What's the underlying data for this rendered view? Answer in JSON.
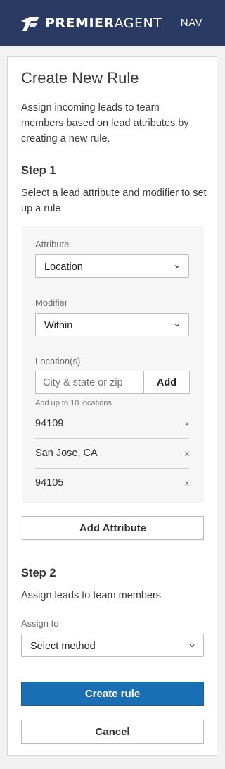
{
  "header": {
    "brand_bold": "PREMIER",
    "brand_light": "AGENT",
    "nav_label": "NAV",
    "color": "#2a3a63"
  },
  "form": {
    "title": "Create New Rule",
    "intro": "Assign incoming leads to team members based on lead attributes by creating a new rule.",
    "step1": {
      "heading": "Step 1",
      "description": "Select a lead attribute and modifier to set up a rule",
      "attribute_label": "Attribute",
      "attribute_value": "Location",
      "modifier_label": "Modifier",
      "modifier_value": "Within",
      "locations_label": "Location(s)",
      "location_placeholder": "City & state or zip",
      "add_label": "Add",
      "hint": "Add up to 10 locations",
      "locations": [
        "94109",
        "San Jose, CA",
        "94105"
      ],
      "remove_glyph": "x",
      "add_attribute_label": "Add Attribute"
    },
    "step2": {
      "heading": "Step 2",
      "description": "Assign leads to team members",
      "assign_label": "Assign to",
      "assign_value": "Select method"
    },
    "create_label": "Create rule",
    "cancel_label": "Cancel",
    "primary_color": "#1a6eb3"
  }
}
